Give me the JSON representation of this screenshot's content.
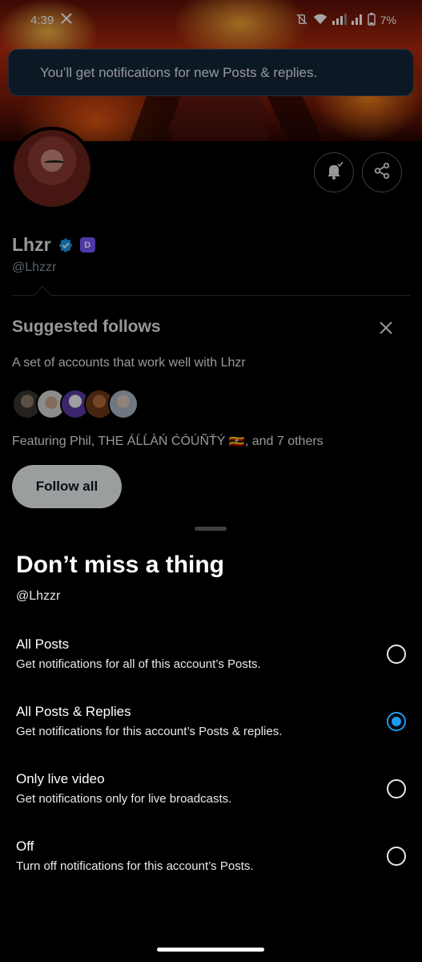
{
  "status_bar": {
    "time": "4:39",
    "app_icon": "x-logo-icon",
    "battery": "7%"
  },
  "toast": {
    "message": "You’ll get notifications for new Posts & replies."
  },
  "profile": {
    "name": "Lhzr",
    "handle": "@Lhzzr",
    "badge_letter": "D",
    "verified_color": "#1d9bf0",
    "badge_color": "#7856ff"
  },
  "suggested": {
    "title": "Suggested follows",
    "description": "A set of accounts that work well with Lhzr",
    "featuring": "Featuring Phil, THE ÁĹĹÀŃ ĆÓÚÑŤÝ 🇺🇬, and 7 others",
    "follow_all_label": "Follow all"
  },
  "sheet": {
    "title": "Don’t miss a thing",
    "handle": "@Lhzzr",
    "options": [
      {
        "label": "All Posts",
        "sub": "Get notifications for all of this account’s Posts.",
        "selected": false
      },
      {
        "label": "All Posts & Replies",
        "sub": "Get notifications for this account’s Posts & replies.",
        "selected": true
      },
      {
        "label": "Only live video",
        "sub": "Get notifications only for live broadcasts.",
        "selected": false
      },
      {
        "label": "Off",
        "sub": "Turn off notifications for this account’s Posts.",
        "selected": false
      }
    ]
  },
  "colors": {
    "accent": "#1d9bf0",
    "toast_bg": "#14263a"
  }
}
